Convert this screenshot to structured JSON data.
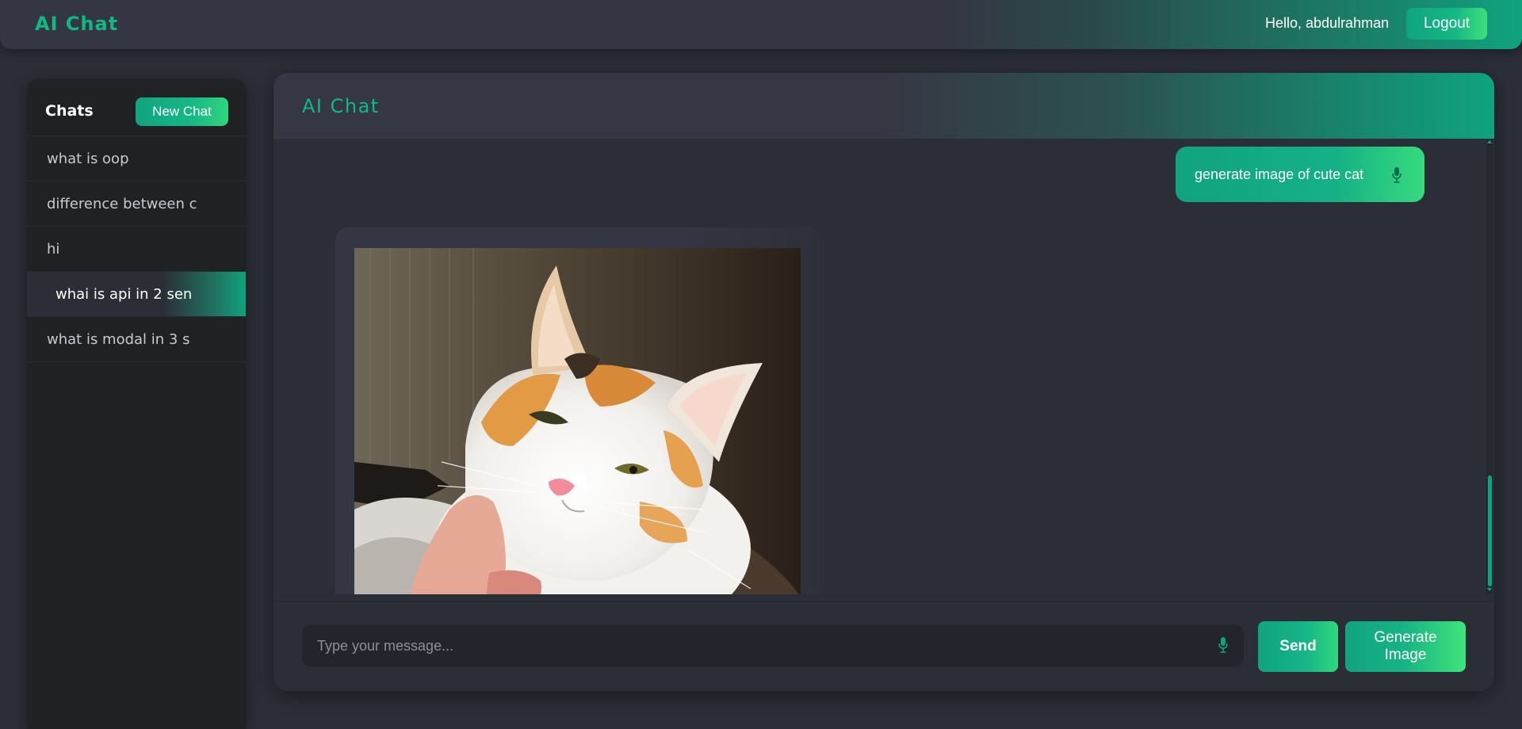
{
  "navbar": {
    "brand": "AI Chat",
    "greeting": "Hello, abdulrahman",
    "logout_label": "Logout"
  },
  "sidebar": {
    "title": "Chats",
    "new_chat_label": "New Chat",
    "items": [
      {
        "label": "what is oop",
        "active": false
      },
      {
        "label": "difference between c",
        "active": false
      },
      {
        "label": "hi",
        "active": false
      },
      {
        "label": "whai is api in 2 sen",
        "active": true
      },
      {
        "label": "what is modal in 3 s",
        "active": false
      }
    ]
  },
  "chat": {
    "title": "AI Chat",
    "messages": [
      {
        "role": "user",
        "text": "generate image of cute cat",
        "icon": "microphone-icon"
      },
      {
        "role": "assistant",
        "type": "image",
        "icon": "generated-cat-image"
      }
    ]
  },
  "composer": {
    "placeholder": "Type your message...",
    "value": "",
    "mic_icon": "microphone-icon",
    "send_label": "Send",
    "generate_label": "Generate Image"
  },
  "colors": {
    "accent": "#10a37f",
    "accent_light": "#3ee07a",
    "background": "#2b2e37",
    "sidebar_bg": "#202123",
    "brand_text": "#10b981"
  }
}
